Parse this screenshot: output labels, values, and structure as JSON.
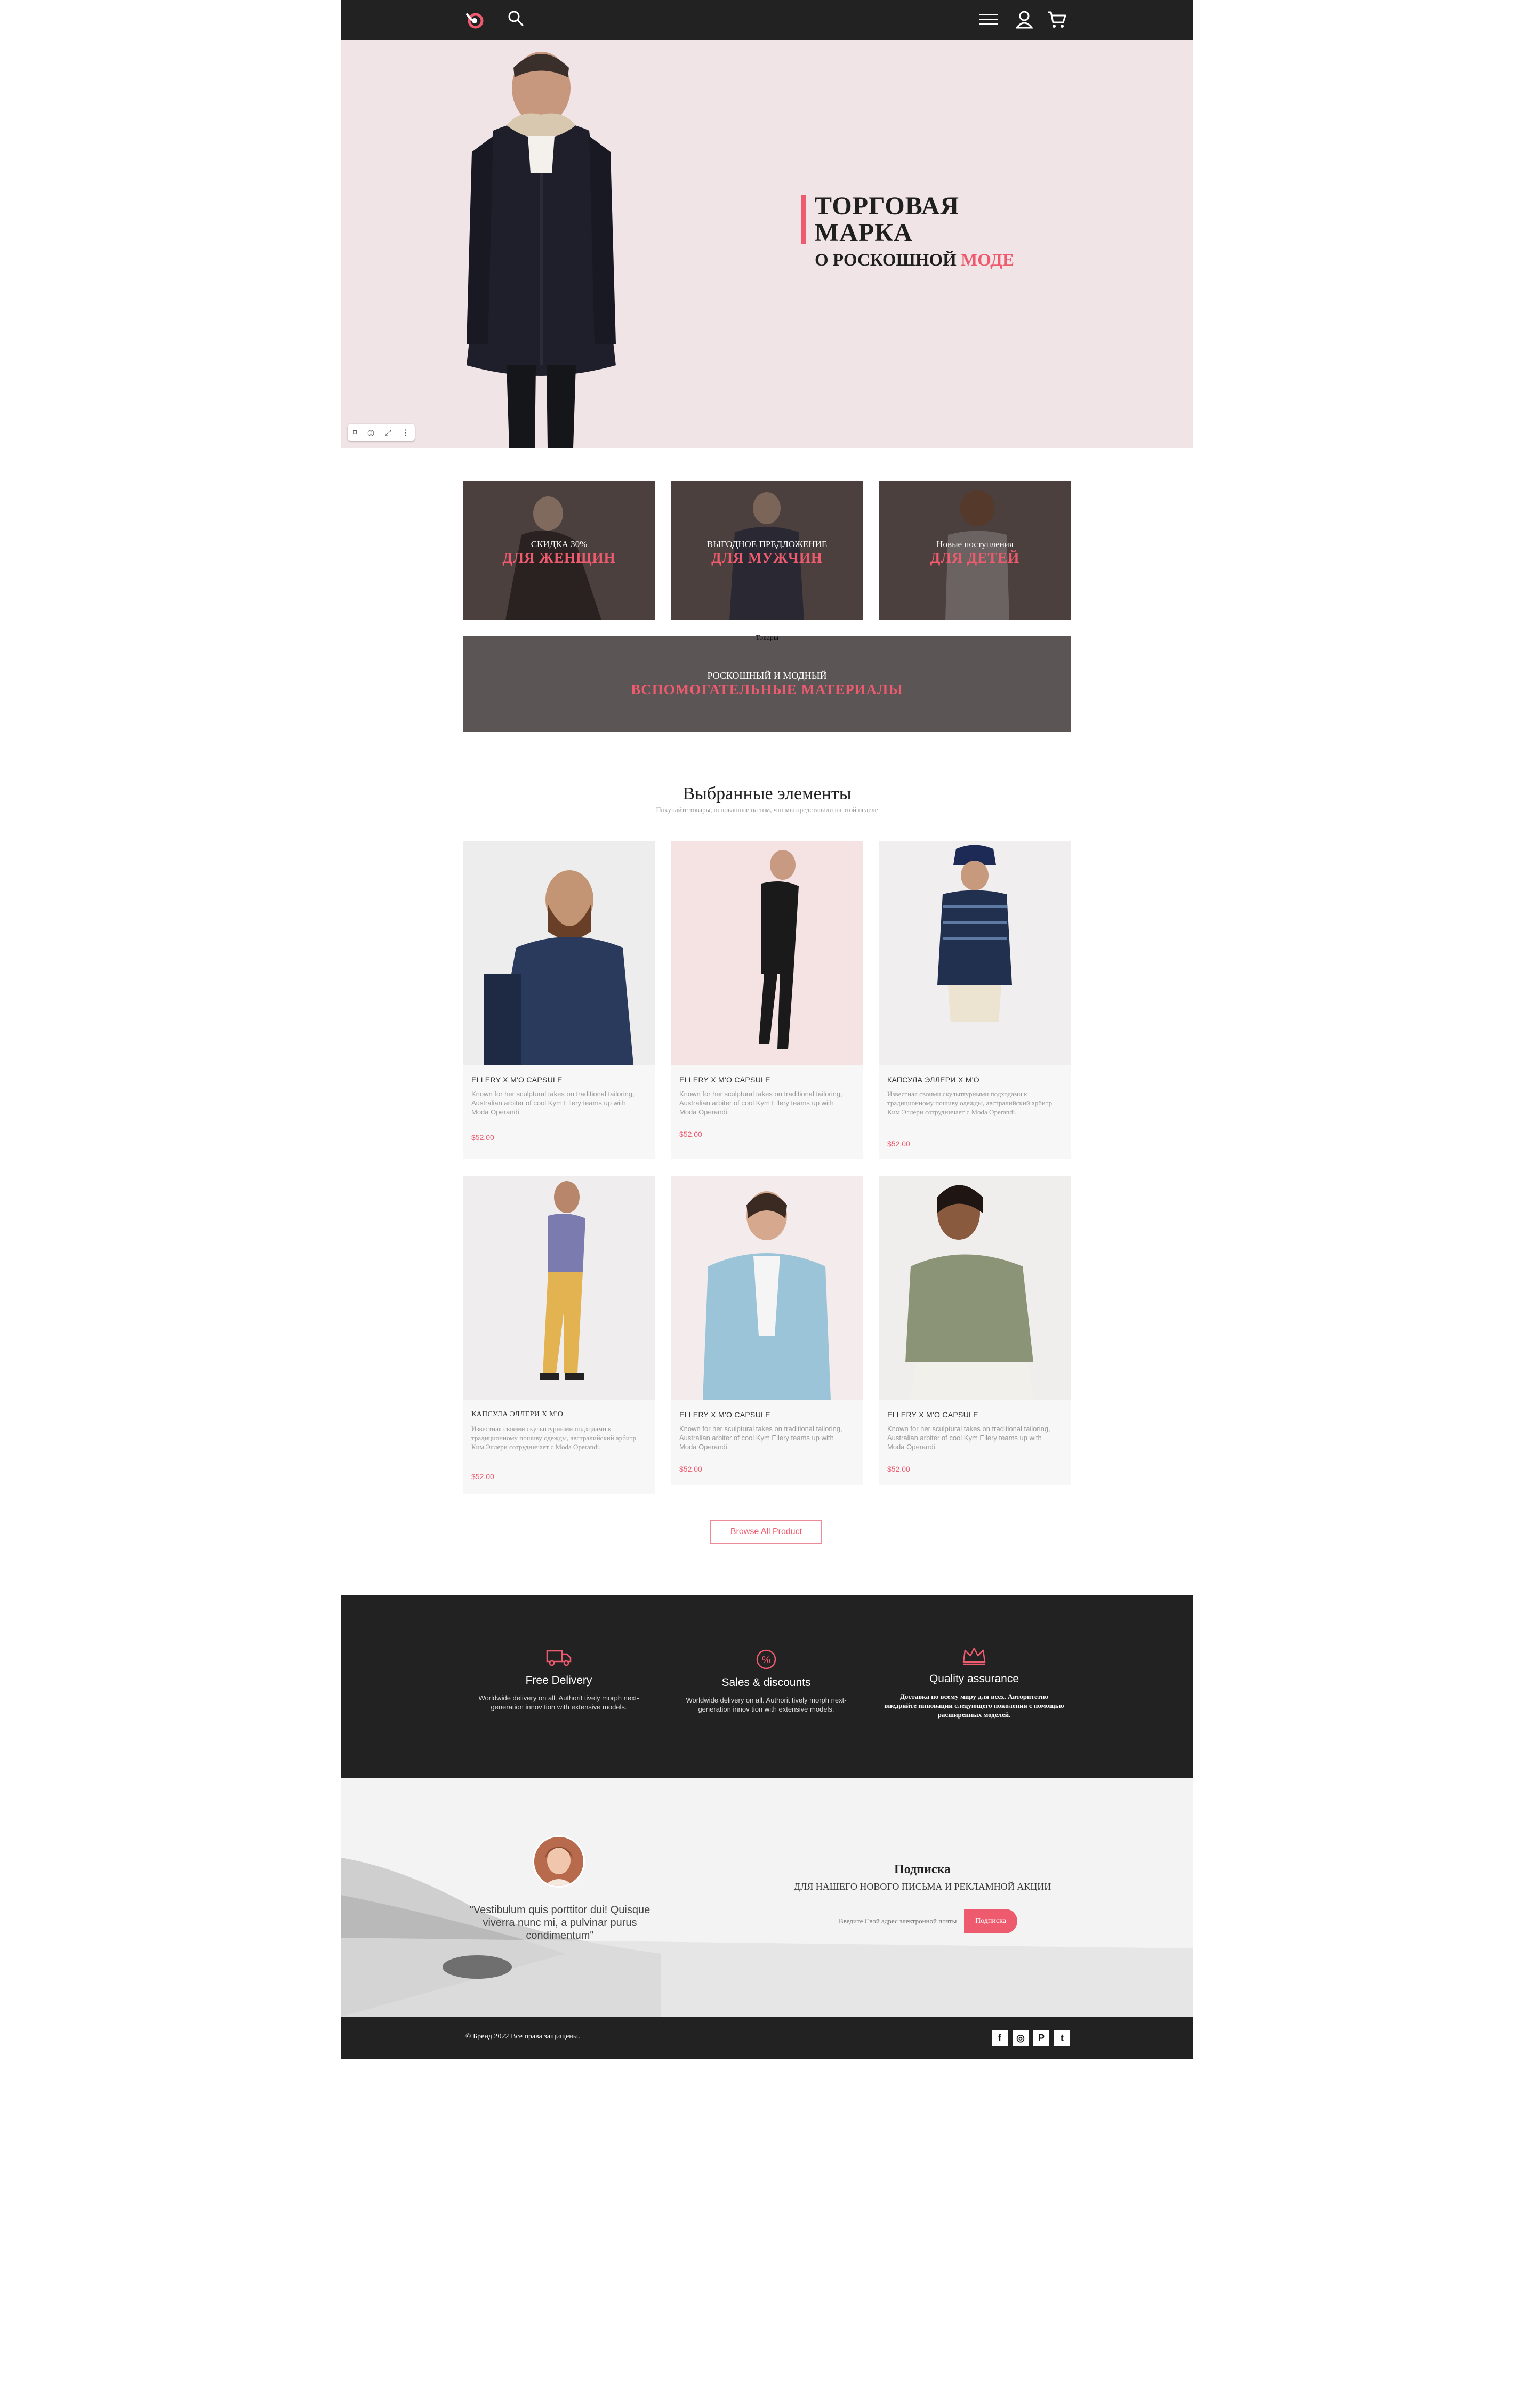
{
  "header": {
    "logo": "logo-mark",
    "icons": [
      "search-icon",
      "menu-icon",
      "user-icon",
      "cart-icon"
    ]
  },
  "hero": {
    "title_line1": "ТОРГОВАЯ",
    "title_line2": "МАРКА",
    "subtitle_prefix": "О РОСКОШНОЙ ",
    "subtitle_accent": "МОДЕ",
    "toolbar_icons": [
      "⌑",
      "◎",
      "⤢",
      "⋮"
    ]
  },
  "promos": [
    {
      "small": "СКИДКА 30%",
      "big": "ДЛЯ ЖЕНЩИН"
    },
    {
      "small": "ВЫГОДНОЕ ПРЕДЛОЖЕНИЕ",
      "big": "ДЛЯ МУЖЧИН"
    },
    {
      "small": "Новые поступления",
      "big": "ДЛЯ ДЕТЕЙ"
    }
  ],
  "wide_banner": {
    "tag": "Товары",
    "small": "РОСКОШНЫЙ И МОДНЫЙ",
    "big": "ВСПОМОГАТЕЛЬНЫЕ МАТЕРИАЛЫ"
  },
  "featured": {
    "title": "Выбранные элементы",
    "subtitle": "Покупайте товары, основанные на том, что мы представили на этой неделе",
    "products": [
      {
        "name": "ELLERY X M'O CAPSULE",
        "desc": "Known for her sculptural takes on traditional tailoring, Australian arbiter of cool Kym Ellery teams up with Moda Operandi.",
        "price": "$52.00"
      },
      {
        "name": "ELLERY X M'O CAPSULE",
        "desc": "Known for her sculptural takes on traditional tailoring, Australian arbiter of cool Kym Ellery teams up with Moda Operandi.",
        "price": "$52.00"
      },
      {
        "name": "КАПСУЛА ЭЛЛЕРИ X M'O",
        "desc": "Известная своими скульптурными подходами к традиционному пошиву одежды, австралийский арбитр Ким Эллери сотрудничает с Moda Operandi.",
        "price": "$52.00"
      },
      {
        "name": "КАПСУЛА ЭЛЛЕРИ X M'O",
        "desc": "Известная своими скульптурными подходами к традиционному пошиву одежды, австралийский арбитр Ким Эллери сотрудничает с Moda Operandi.",
        "price": "$52.00"
      },
      {
        "name": "ELLERY X M'O CAPSULE",
        "desc": "Known for her sculptural takes on traditional tailoring, Australian arbiter of cool Kym Ellery teams up with Moda Operandi.",
        "price": "$52.00"
      },
      {
        "name": "ELLERY X M'O CAPSULE",
        "desc": "Known for her sculptural takes on traditional tailoring, Australian arbiter of cool Kym Ellery teams up with Moda Operandi.",
        "price": "$52.00"
      }
    ],
    "browse_label": "Browse All Product"
  },
  "features": [
    {
      "icon": "truck-icon",
      "title": "Free Delivery",
      "desc": "Worldwide delivery on all. Authorit tively morph next-generation innov tion with extensive models."
    },
    {
      "icon": "discount-icon",
      "title": "Sales & discounts",
      "desc": "Worldwide delivery on all. Authorit tively morph next-generation innov tion with extensive models."
    },
    {
      "icon": "crown-icon",
      "title": "Quality assurance",
      "desc": "Доставка по всему миру для всех. Авторитетно внедряйте инновации следующего поколения с помощью расширенных моделей."
    }
  ],
  "testimonial": {
    "quote": "\"Vestibulum quis porttitor dui! Quisque viverra nunc mi, a pulvinar purus condimentum\""
  },
  "subscribe": {
    "title": "Подписка",
    "text": "ДЛЯ НАШЕГО НОВОГО ПИСЬМА И РЕКЛАМНОЙ АКЦИИ",
    "placeholder": "Введите Свой адрес электронной почты",
    "button": "Подписка"
  },
  "footer": {
    "copyright": "© Бренд 2022 Все права защищены.",
    "social": [
      "f",
      "◎",
      "P",
      "t"
    ]
  },
  "colors": {
    "accent": "#ee5b6e",
    "dark": "#222222",
    "hero_bg": "#f1e4e7"
  }
}
